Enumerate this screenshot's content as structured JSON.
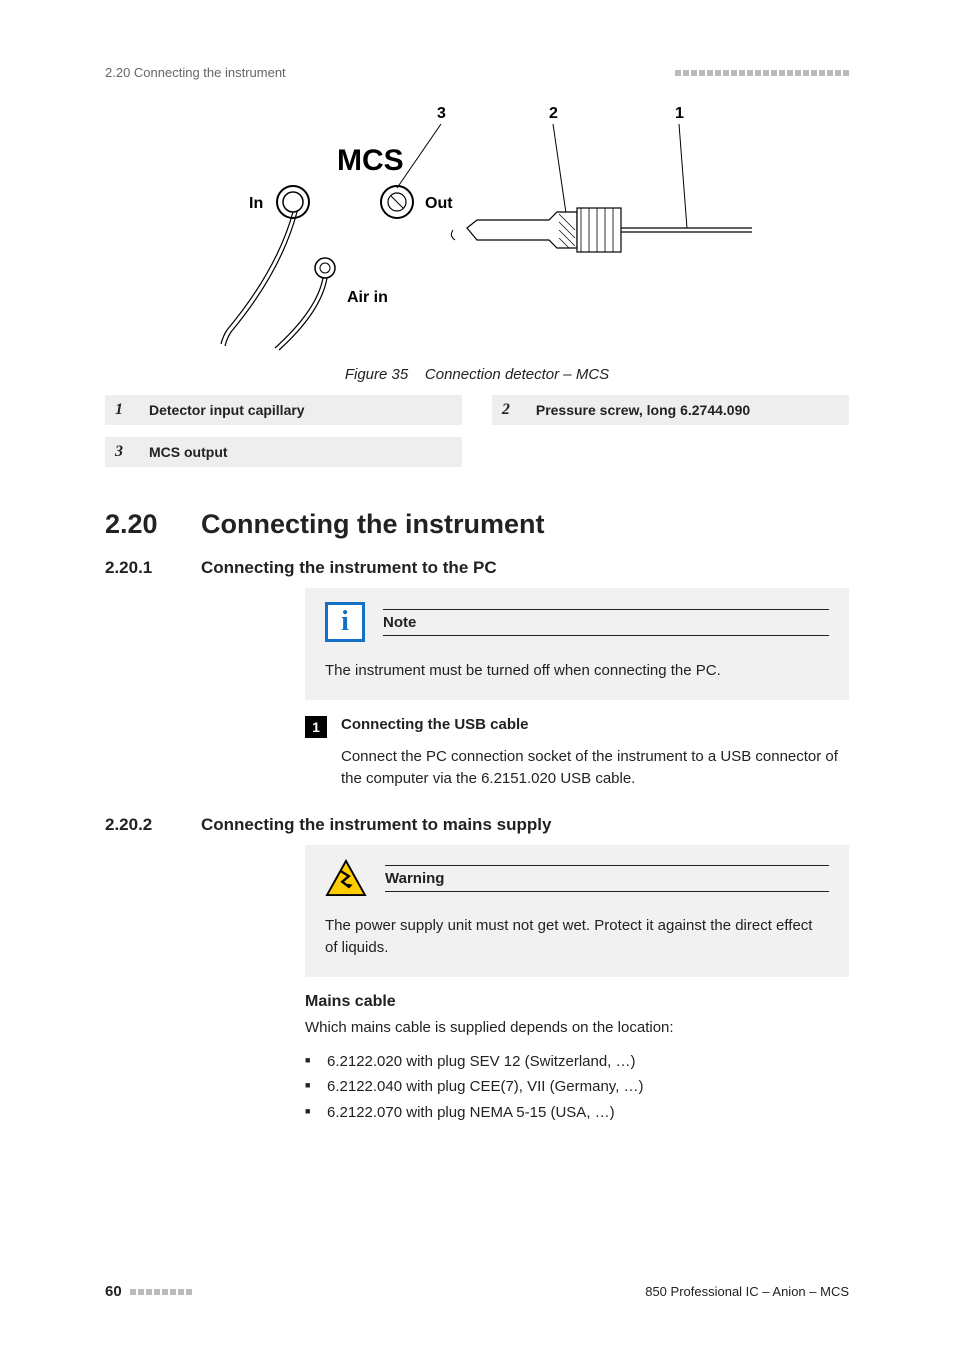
{
  "header": {
    "running": "2.20 Connecting the instrument"
  },
  "figure": {
    "mcs": "MCS",
    "in": "In",
    "out": "Out",
    "air": "Air in",
    "callouts": {
      "c1": "1",
      "c2": "2",
      "c3": "3"
    },
    "caption_label": "Figure 35",
    "caption_text": "Connection detector – MCS"
  },
  "legend": {
    "r1": {
      "n": "1",
      "t": "Detector input capillary"
    },
    "r2": {
      "n": "2",
      "t": "Pressure screw, long 6.2744.090"
    },
    "r3": {
      "n": "3",
      "t": "MCS output"
    }
  },
  "section": {
    "num": "2.20",
    "title": "Connecting the instrument"
  },
  "sub1": {
    "num": "2.20.1",
    "title": "Connecting the instrument to the PC",
    "note_label": "Note",
    "note_text": "The instrument must be turned off when connecting the PC.",
    "step_num": "1",
    "step_title": "Connecting the USB cable",
    "step_body": "Connect the PC connection socket of the instrument to a USB connector of the computer via the 6.2151.020 USB cable."
  },
  "sub2": {
    "num": "2.20.2",
    "title": "Connecting the instrument to mains supply",
    "warn_label": "Warning",
    "warn_text": "The power supply unit must not get wet. Protect it against the direct effect of liquids.",
    "mains_head": "Mains cable",
    "mains_intro": "Which mains cable is supplied depends on the location:",
    "cables": [
      "6.2122.020 with plug SEV 12 (Switzerland, …)",
      "6.2122.040 with plug CEE(7), VII (Germany, …)",
      "6.2122.070 with plug NEMA 5-15 (USA, …)"
    ]
  },
  "footer": {
    "page": "60",
    "doc": "850 Professional IC – Anion – MCS"
  }
}
